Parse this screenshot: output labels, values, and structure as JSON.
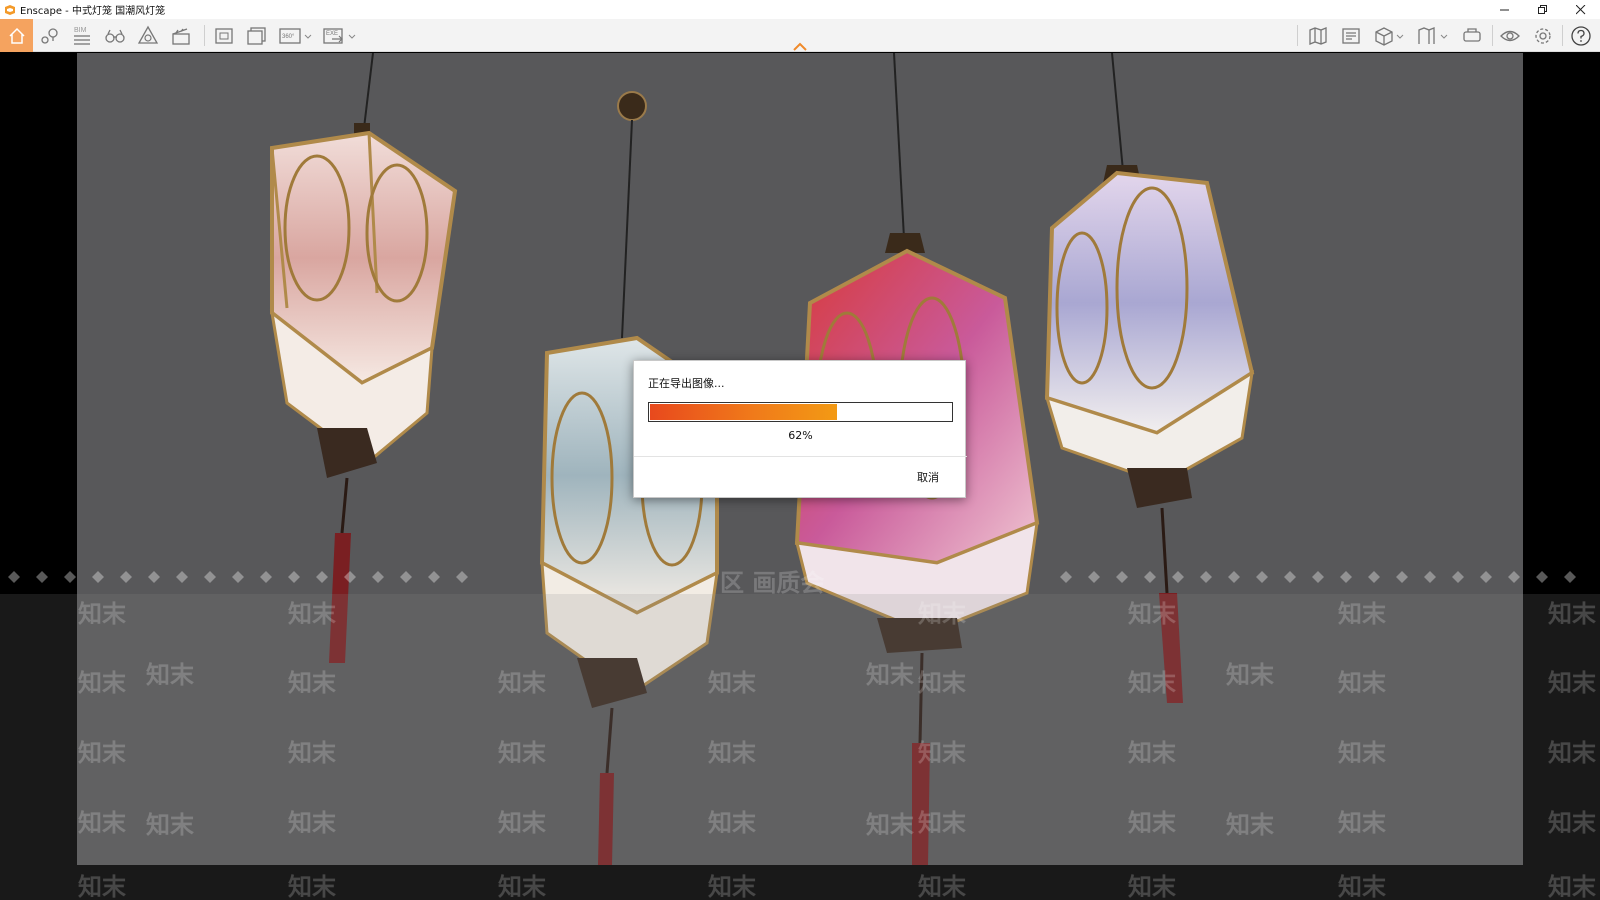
{
  "window": {
    "title": "Enscape - 中式灯笼  国潮风灯笼",
    "controls": [
      "minimize-icon",
      "restore-icon",
      "close-icon"
    ]
  },
  "toolbar": {
    "left_icons": [
      "home-icon",
      "location-pin-icon",
      "bim-list-icon",
      "binoculars-icon",
      "atmosphere-icon",
      "clapper-icon",
      "screenshot-icon",
      "batch-render-icon",
      "panorama-360-icon",
      "export-exe-icon"
    ],
    "bim_label": "BIM",
    "panorama_label": "360°",
    "exe_label": "EXE",
    "right_icons": [
      "map-icon",
      "asset-library-icon",
      "cube-view-icon",
      "bookmark-icon",
      "vr-headset-icon",
      "eye-icon",
      "settings-gear-icon",
      "help-icon"
    ],
    "accent": "#f5a35f"
  },
  "dialog": {
    "title": "正在导出图像...",
    "progress": 0.62,
    "progress_text": "62%",
    "cancel_label": "取消"
  },
  "watermark": {
    "text": "知末",
    "overlay_text": "区  画质会"
  }
}
